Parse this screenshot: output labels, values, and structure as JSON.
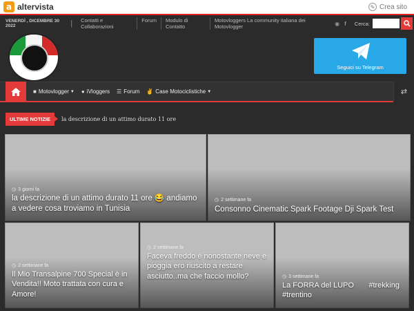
{
  "altervista": {
    "brand": "altervista",
    "logo_letter": "a",
    "create_label": "Crea sito"
  },
  "topbar": {
    "date": "VENERDÌ , DICEMBRE 30 2022",
    "links": [
      "Contatti e Collaborazioni",
      "Forum",
      "Modulo di Contatto",
      "Motovloggers La community italiana dei Motovlogger"
    ],
    "search_label": "Cerca:"
  },
  "telegram": {
    "label": "Seguici su Telegram"
  },
  "nav": {
    "items": [
      {
        "label": "Motovlogger",
        "icon": "video-icon",
        "dropdown": true
      },
      {
        "label": "iVloggers",
        "icon": "user-icon",
        "dropdown": false
      },
      {
        "label": "Forum",
        "icon": "list-icon",
        "dropdown": false
      },
      {
        "label": "Case Motociclistiche",
        "icon": "hand-icon",
        "dropdown": true
      }
    ]
  },
  "ticker": {
    "badge": "ULTIME NOTIZIE",
    "text": "la descrizione di un attimo durato 11 ore"
  },
  "posts": [
    {
      "time": "3 giorni fa",
      "title": "la descrizione di un attimo durato 11 ore 😂 andiamo a vedere cosa troviamo in Tunisia"
    },
    {
      "time": "2 settimane fa",
      "title": "Consonno Cinematic Spark Footage Dji Spark Test"
    },
    {
      "time": "2 settimane fa",
      "title": "Il Mio Transalpine 700 Special è in Vendita!! Moto trattata con cura e Amore!"
    },
    {
      "time": "2 settimane fa",
      "title": "Faceva freddo è nonostante neve e pioggia ero riuscito a restare asciutto..ma che faccio mollo?"
    },
    {
      "time": "3 settimane fa",
      "title": "La FORRA del LUPO       #trekking #trentino"
    }
  ],
  "colors": {
    "accent": "#e43a3a",
    "telegram": "#29a8e8",
    "background": "#2b2b2b"
  }
}
